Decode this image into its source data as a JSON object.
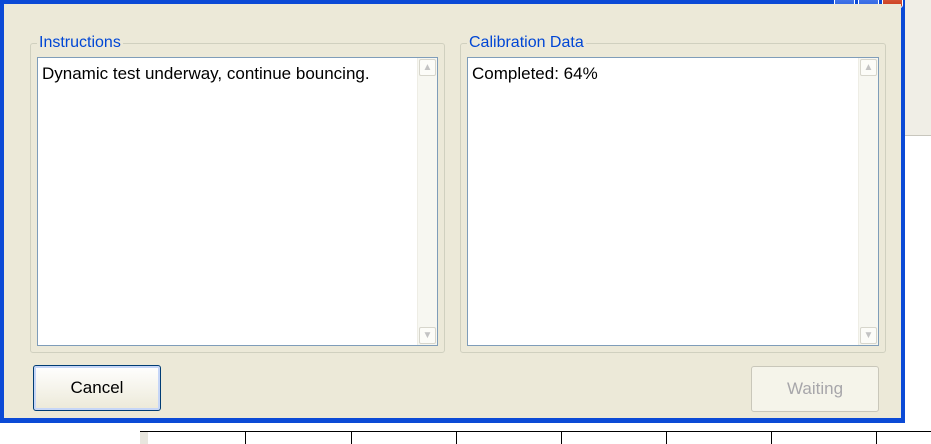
{
  "dialog": {
    "instructions": {
      "legend": "Instructions",
      "text": "Dynamic test underway, continue bouncing."
    },
    "calibration": {
      "legend": "Calibration Data",
      "text": "Completed: 64%"
    },
    "buttons": {
      "cancel": "Cancel",
      "waiting": "Waiting"
    }
  },
  "colors": {
    "title_bar": "#0b4ad6",
    "dialog_face": "#ece9d8",
    "legend_text": "#0046d5",
    "disabled_text": "#a7a6aa"
  },
  "icons": {
    "scroll_up": "▲",
    "scroll_down": "▼"
  }
}
